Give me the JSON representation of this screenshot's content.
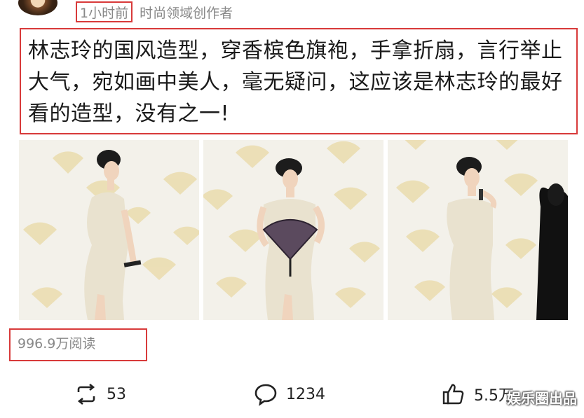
{
  "header": {
    "time_label": "1小时前",
    "author_role": "时尚领域创作者"
  },
  "post": {
    "text": "林志玲的国风造型，穿香槟色旗袍，手拿折扇，言行举止大气，宛如画中美人，毫无疑问，这应该是林志玲的最好看的造型，没有之一!"
  },
  "stats": {
    "reads": "996.9万阅读"
  },
  "actions": {
    "repost_count": "53",
    "comment_count": "1234",
    "like_count": "5.5万"
  },
  "watermark": "娱乐圈出品",
  "icons": {
    "repost": "repost-icon",
    "comment": "comment-icon",
    "like": "thumbs-up-icon"
  },
  "colors": {
    "highlight_border": "#d83a3a",
    "meta_text": "#888888",
    "dress": "#e9e2cf",
    "fan_motif": "#e8d8a8"
  }
}
